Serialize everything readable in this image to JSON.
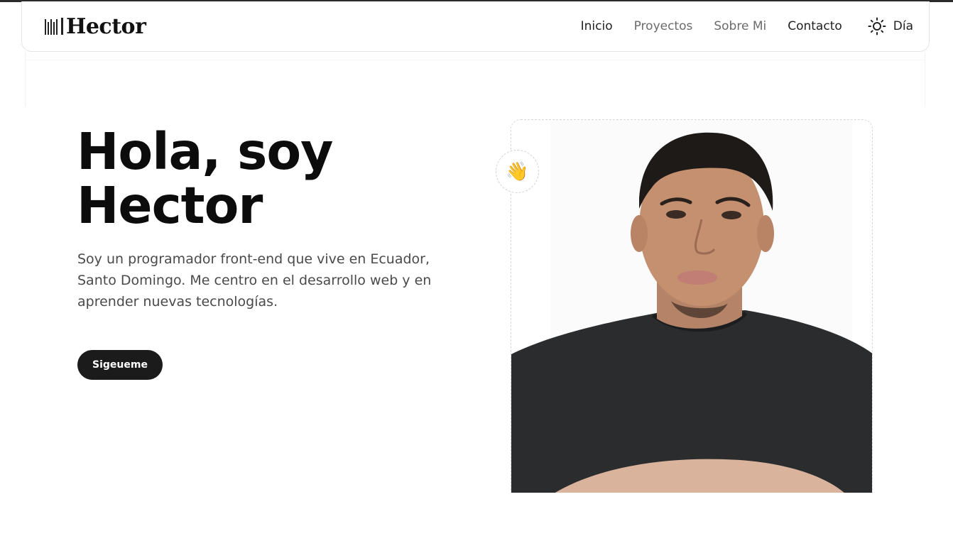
{
  "brand": {
    "name": "Hector"
  },
  "nav": {
    "links": [
      {
        "label": "Inicio"
      },
      {
        "label": "Proyectos"
      },
      {
        "label": "Sobre Mi"
      },
      {
        "label": "Contacto"
      }
    ],
    "theme_label": "Día",
    "theme_icon": "sun-icon"
  },
  "hero": {
    "title_line1": "Hola, soy",
    "title_line2": "Hector",
    "description": "Soy un programador front-end que vive en Ecuador, Santo Domingo. Me centro en el desarrollo web y en aprender nuevas tecnologías.",
    "button_label": "Sigeueme",
    "wave_emoji": "👋",
    "photo_icon": "portrait-photo"
  },
  "colors": {
    "accent_dark": "#1b1b1b",
    "text_muted": "#6b6b6b"
  }
}
